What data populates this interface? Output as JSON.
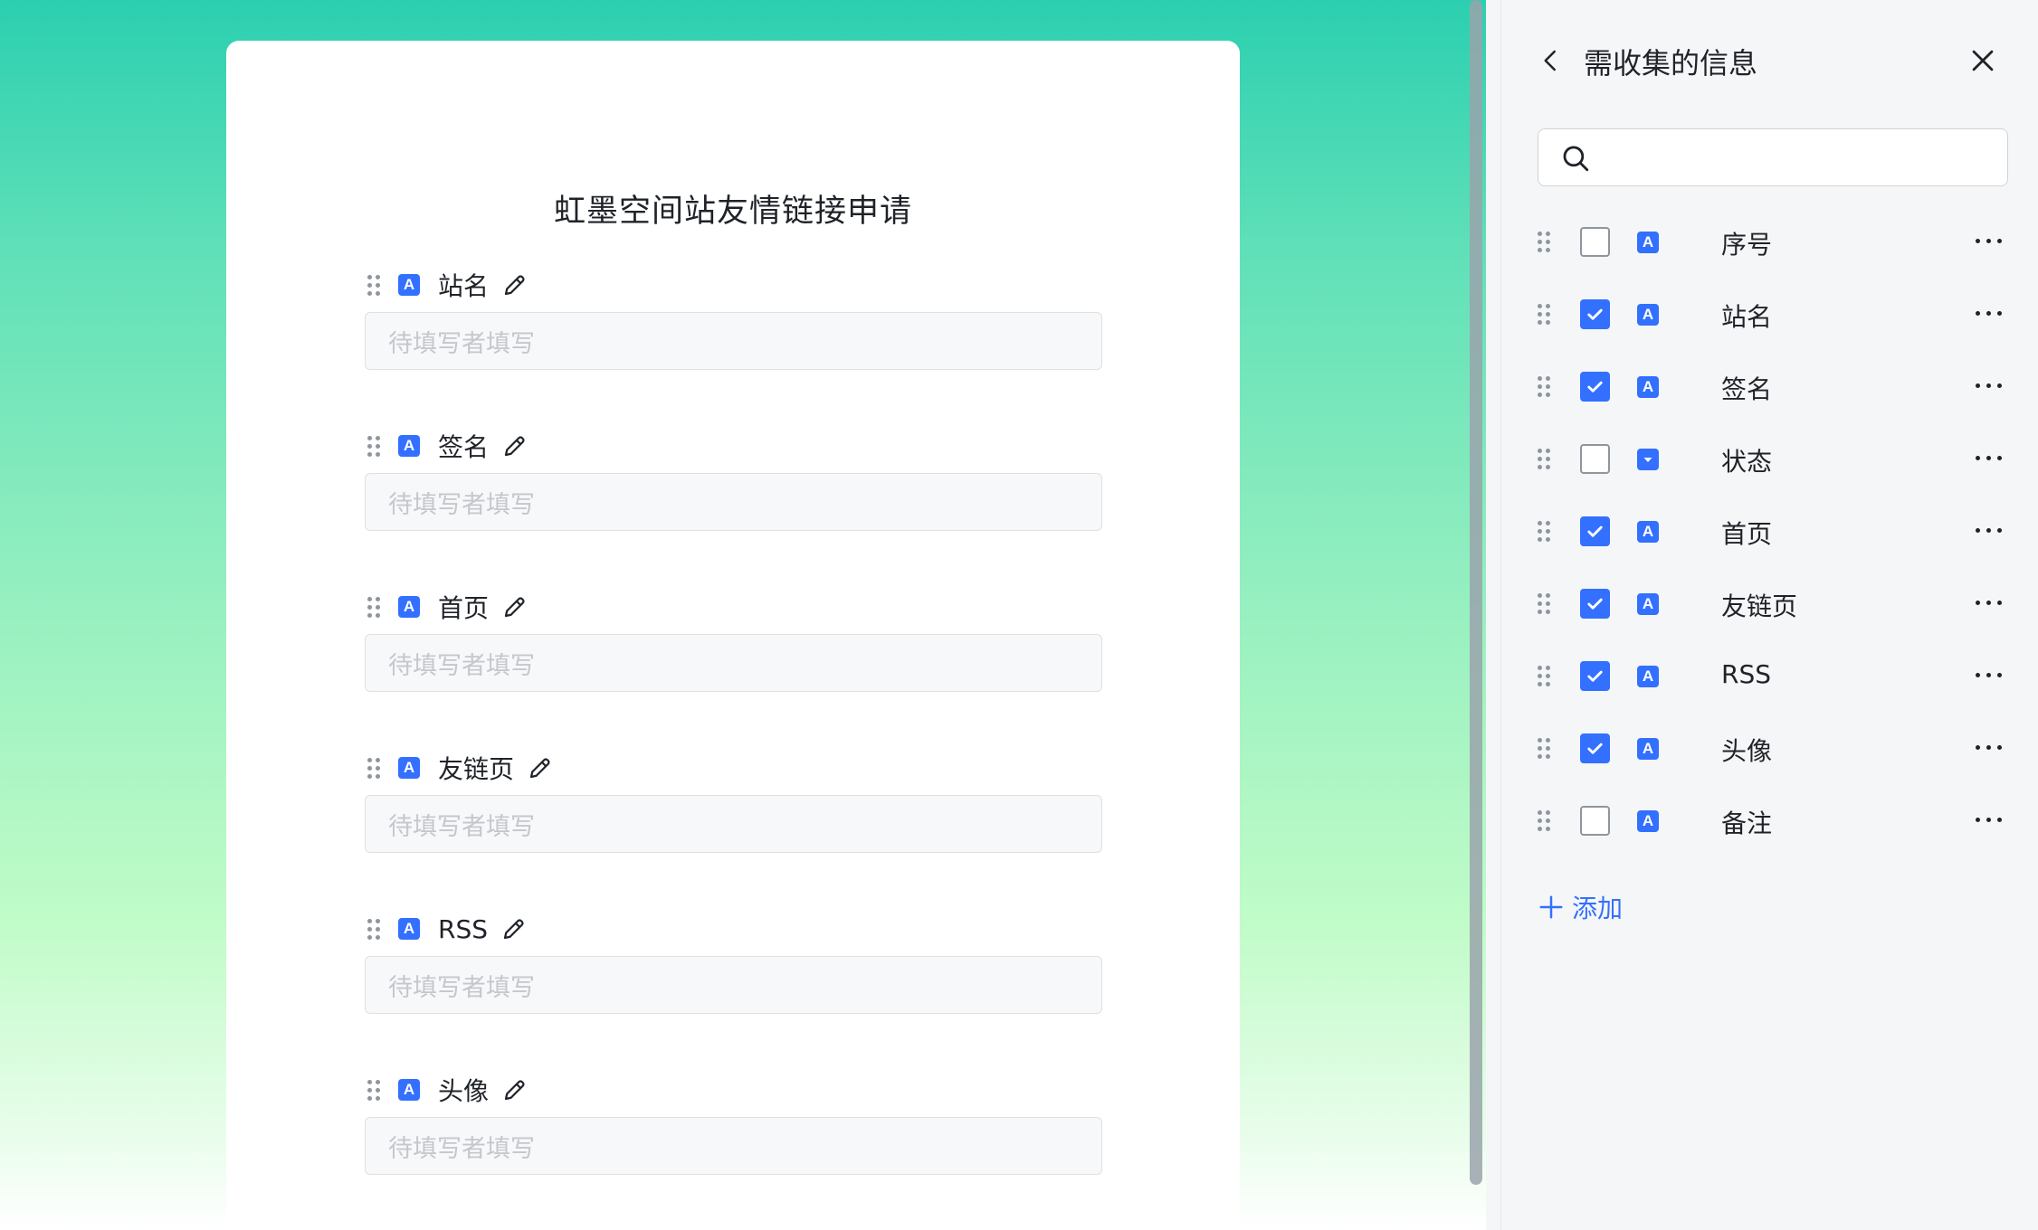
{
  "form": {
    "title": "虹墨空间站友情链接申请",
    "placeholder": "待填写者填写",
    "fields": [
      {
        "label": "站名"
      },
      {
        "label": "签名"
      },
      {
        "label": "首页"
      },
      {
        "label": "友链页"
      },
      {
        "label": "RSS"
      },
      {
        "label": "头像"
      }
    ]
  },
  "panel": {
    "title": "需收集的信息",
    "search_placeholder": "",
    "add_label": "添加",
    "items": [
      {
        "label": "序号",
        "checked": false,
        "type_icon": "text-type-icon"
      },
      {
        "label": "站名",
        "checked": true,
        "type_icon": "text-type-icon"
      },
      {
        "label": "签名",
        "checked": true,
        "type_icon": "text-type-icon"
      },
      {
        "label": "状态",
        "checked": false,
        "type_icon": "select-type-icon"
      },
      {
        "label": "首页",
        "checked": true,
        "type_icon": "text-type-icon"
      },
      {
        "label": "友链页",
        "checked": true,
        "type_icon": "text-type-icon"
      },
      {
        "label": "RSS",
        "checked": true,
        "type_icon": "text-type-icon"
      },
      {
        "label": "头像",
        "checked": true,
        "type_icon": "text-type-icon"
      },
      {
        "label": "备注",
        "checked": false,
        "type_icon": "text-type-icon"
      }
    ]
  },
  "icons": {
    "type_letter": "A"
  },
  "colors": {
    "accent": "#3370ff",
    "gradient_top": "#2bcfb0",
    "gradient_bottom": "#ffffff"
  }
}
